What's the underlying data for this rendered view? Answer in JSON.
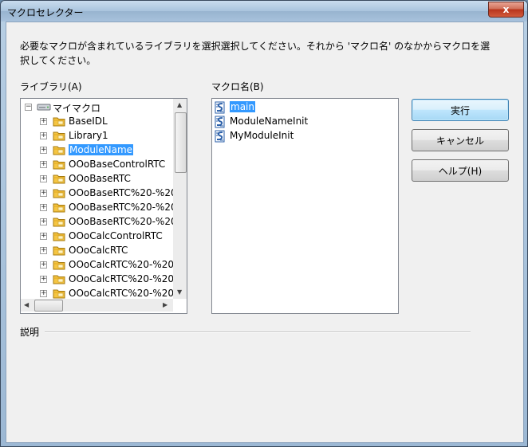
{
  "window": {
    "title": "マクロセレクター",
    "close_glyph": "x"
  },
  "description": "必要なマクロが含まれているライブラリを選択選択してください。それから 'マクロ名' のなかからマクロを選択してください。",
  "library": {
    "label": "ライブラリ(A)",
    "root": "マイマクロ",
    "items": [
      "BaseIDL",
      "Library1",
      "ModuleName",
      "OOoBaseControlRTC",
      "OOoBaseRTC",
      "OOoBaseRTC%20-%20",
      "OOoBaseRTC%20-%20",
      "OOoBaseRTC%20-%20",
      "OOoCalcControlRTC",
      "OOoCalcRTC",
      "OOoCalcRTC%20-%20",
      "OOoCalcRTC%20-%20",
      "OOoCalcRTC%20-%20"
    ],
    "selected_index": 2
  },
  "macro_names": {
    "label": "マクロ名(B)",
    "items": [
      "main",
      "ModuleNameInit",
      "MyModuleInit"
    ],
    "selected_index": 0
  },
  "buttons": {
    "run": "実行",
    "cancel": "キャンセル",
    "help": "ヘルプ(H)"
  },
  "explanation_label": "説明",
  "icons": {
    "root": "drive-icon",
    "library": "folder-icon",
    "macro": "basic-macro-icon"
  },
  "colors": {
    "selection": "#3399ff",
    "folder": "#f5c542",
    "macro_icon": "#2a5fa8"
  }
}
